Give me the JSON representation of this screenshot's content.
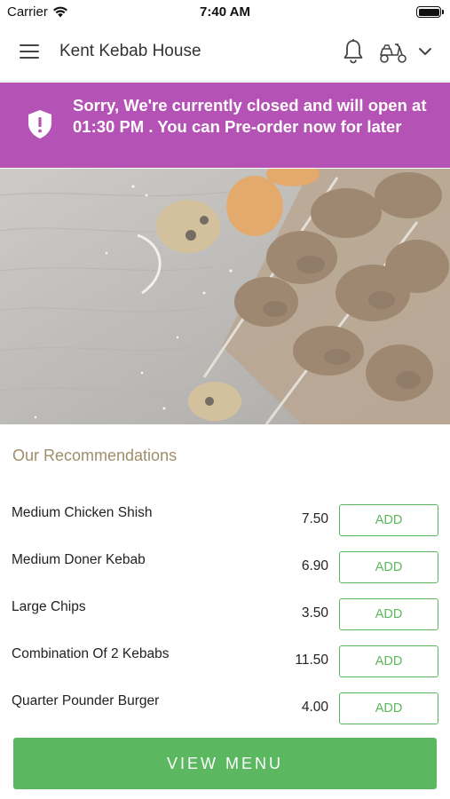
{
  "status_bar": {
    "carrier": "Carrier",
    "time": "7:40 AM"
  },
  "header": {
    "store_name": "Kent Kebab House",
    "icons": [
      "menu-icon",
      "bell-icon",
      "scooter-icon",
      "chevron-down-icon"
    ]
  },
  "banner": {
    "message": "Sorry, We're currently closed and will open at 01:30 PM . You can Pre-order now for later",
    "icon": "shield-icon",
    "color": "#b452b6"
  },
  "hero": {
    "image": "kebab skewers on wooden board"
  },
  "recommendations": {
    "title": "Our Recommendations",
    "items": [
      {
        "name": "Medium Chicken Shish",
        "price": "7.50",
        "add_label": "ADD"
      },
      {
        "name": "Medium Doner Kebab",
        "price": "6.90",
        "add_label": "ADD"
      },
      {
        "name": "Large Chips",
        "price": "3.50",
        "add_label": "ADD"
      },
      {
        "name": "Combination Of 2 Kebabs",
        "price": "11.50",
        "add_label": "ADD"
      },
      {
        "name": "Quarter Pounder Burger",
        "price": "4.00",
        "add_label": "ADD"
      }
    ]
  },
  "footer": {
    "view_menu_label": "VIEW MENU",
    "accent": "#5cb860"
  }
}
